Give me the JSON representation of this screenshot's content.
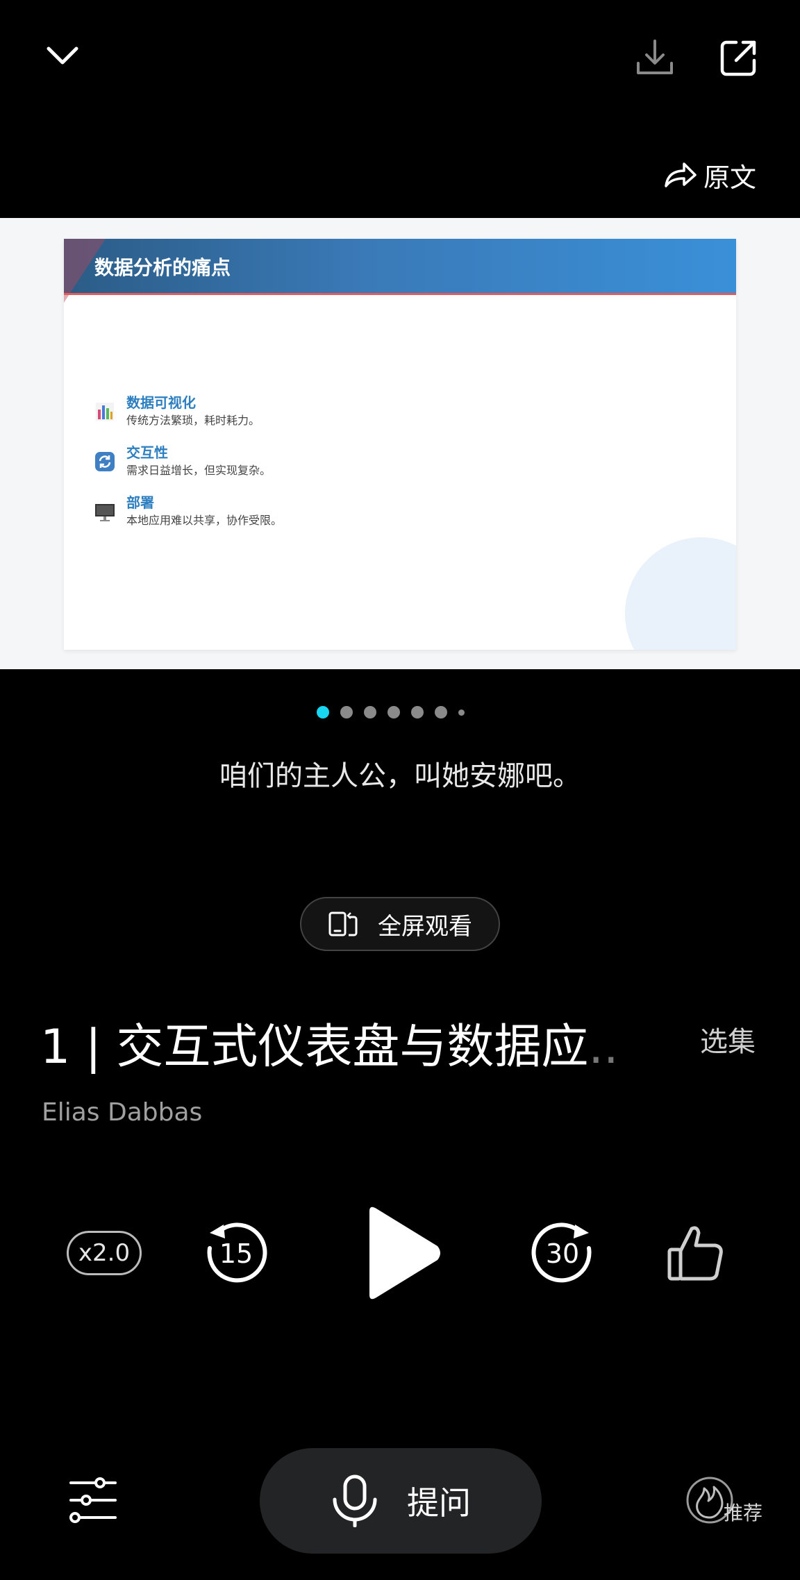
{
  "top_bar": {
    "collapse_icon": "chevron-down-icon",
    "download_icon": "download-icon",
    "share_icon": "share-icon"
  },
  "original_text": {
    "label": "原文",
    "icon": "forward-arrow-icon"
  },
  "slide": {
    "title": "数据分析的痛点",
    "items": [
      {
        "icon": "bar-chart-icon",
        "heading": "数据可视化",
        "text": "传统方法繁琐，耗时耗力。"
      },
      {
        "icon": "refresh-icon",
        "heading": "交互性",
        "text": "需求日益增长，但实现复杂。"
      },
      {
        "icon": "monitor-icon",
        "heading": "部署",
        "text": "本地应用难以共享，协作受限。"
      }
    ]
  },
  "pager": {
    "total_dots": 7,
    "active_index": 0,
    "accent": "#18d6f0"
  },
  "subtitle": "咱们的主人公，叫她安娜吧。",
  "fullscreen": {
    "label": "全屏观看",
    "icon": "rotate-screen-icon"
  },
  "episode": {
    "title": "1 | 交互式仪表盘与数据应",
    "title_overflow": "..",
    "episodes_label": "选集",
    "author": "Elias Dabbas"
  },
  "controls": {
    "speed": "x2.0",
    "rewind_seconds": "15",
    "forward_seconds": "30",
    "play_icon": "play-icon",
    "like_icon": "thumbs-up-icon"
  },
  "bottom_bar": {
    "settings_icon": "sliders-icon",
    "ask_label": "提问",
    "ask_icon": "microphone-icon",
    "recommend_label": "推荐",
    "recommend_icon": "flame-icon"
  }
}
